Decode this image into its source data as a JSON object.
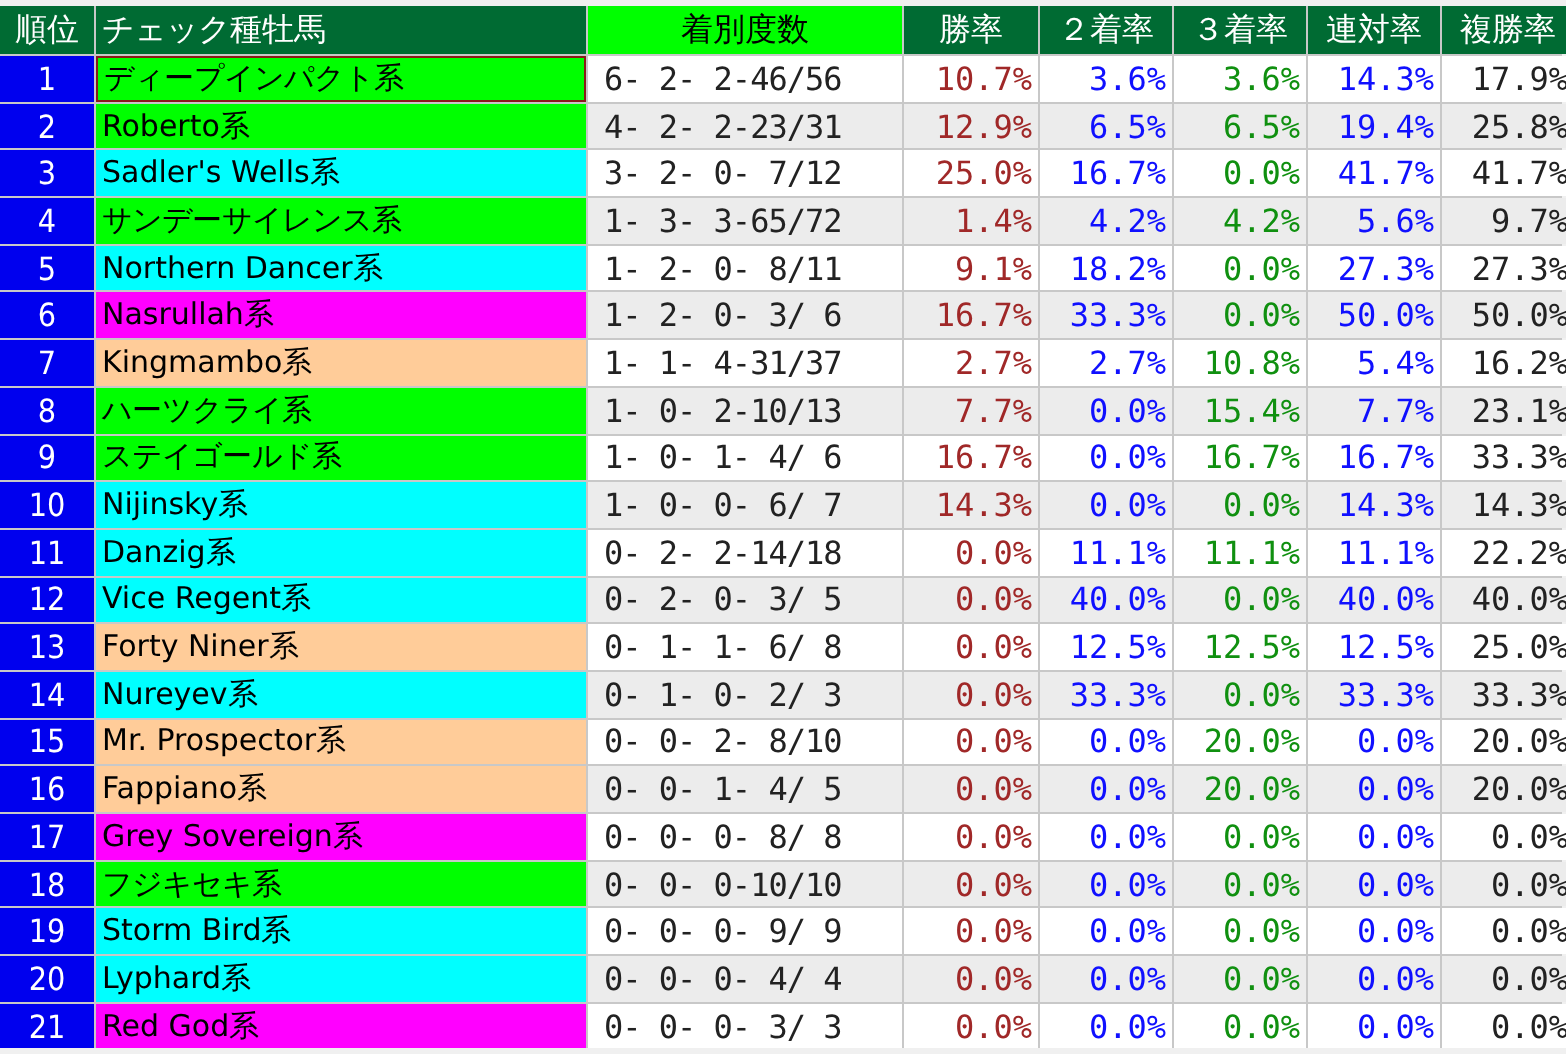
{
  "table": {
    "columns": [
      "順位",
      "チェック種牡馬",
      "着別度数",
      "勝率",
      "２着率",
      "３着率",
      "連対率",
      "複勝率"
    ],
    "rows": [
      {
        "rank": "1",
        "name": "ディープインパクト系",
        "color": "#00ff00",
        "selected": true,
        "record": "6- 2- 2-46/56",
        "win": "10.7%",
        "second": "3.6%",
        "third": "3.6%",
        "top2": "14.3%",
        "top3": "17.9%"
      },
      {
        "rank": "2",
        "name": "Roberto系",
        "color": "#00ff00",
        "selected": false,
        "record": "4- 2- 2-23/31",
        "win": "12.9%",
        "second": "6.5%",
        "third": "6.5%",
        "top2": "19.4%",
        "top3": "25.8%"
      },
      {
        "rank": "3",
        "name": "Sadler's Wells系",
        "color": "#00ffff",
        "selected": false,
        "record": "3- 2- 0- 7/12",
        "win": "25.0%",
        "second": "16.7%",
        "third": "0.0%",
        "top2": "41.7%",
        "top3": "41.7%"
      },
      {
        "rank": "4",
        "name": "サンデーサイレンス系",
        "color": "#00ff00",
        "selected": false,
        "record": "1- 3- 3-65/72",
        "win": "1.4%",
        "second": "4.2%",
        "third": "4.2%",
        "top2": "5.6%",
        "top3": "9.7%"
      },
      {
        "rank": "5",
        "name": "Northern Dancer系",
        "color": "#00ffff",
        "selected": false,
        "record": "1- 2- 0- 8/11",
        "win": "9.1%",
        "second": "18.2%",
        "third": "0.0%",
        "top2": "27.3%",
        "top3": "27.3%"
      },
      {
        "rank": "6",
        "name": "Nasrullah系",
        "color": "#ff00ff",
        "selected": false,
        "record": "1- 2- 0- 3/ 6",
        "win": "16.7%",
        "second": "33.3%",
        "third": "0.0%",
        "top2": "50.0%",
        "top3": "50.0%"
      },
      {
        "rank": "7",
        "name": "Kingmambo系",
        "color": "#ffcc99",
        "selected": false,
        "record": "1- 1- 4-31/37",
        "win": "2.7%",
        "second": "2.7%",
        "third": "10.8%",
        "top2": "5.4%",
        "top3": "16.2%"
      },
      {
        "rank": "8",
        "name": "ハーツクライ系",
        "color": "#00ff00",
        "selected": false,
        "record": "1- 0- 2-10/13",
        "win": "7.7%",
        "second": "0.0%",
        "third": "15.4%",
        "top2": "7.7%",
        "top3": "23.1%"
      },
      {
        "rank": "9",
        "name": "ステイゴールド系",
        "color": "#00ff00",
        "selected": false,
        "record": "1- 0- 1- 4/ 6",
        "win": "16.7%",
        "second": "0.0%",
        "third": "16.7%",
        "top2": "16.7%",
        "top3": "33.3%"
      },
      {
        "rank": "10",
        "name": "Nijinsky系",
        "color": "#00ffff",
        "selected": false,
        "record": "1- 0- 0- 6/ 7",
        "win": "14.3%",
        "second": "0.0%",
        "third": "0.0%",
        "top2": "14.3%",
        "top3": "14.3%"
      },
      {
        "rank": "11",
        "name": "Danzig系",
        "color": "#00ffff",
        "selected": false,
        "record": "0- 2- 2-14/18",
        "win": "0.0%",
        "second": "11.1%",
        "third": "11.1%",
        "top2": "11.1%",
        "top3": "22.2%"
      },
      {
        "rank": "12",
        "name": "Vice Regent系",
        "color": "#00ffff",
        "selected": false,
        "record": "0- 2- 0- 3/ 5",
        "win": "0.0%",
        "second": "40.0%",
        "third": "0.0%",
        "top2": "40.0%",
        "top3": "40.0%"
      },
      {
        "rank": "13",
        "name": "Forty Niner系",
        "color": "#ffcc99",
        "selected": false,
        "record": "0- 1- 1- 6/ 8",
        "win": "0.0%",
        "second": "12.5%",
        "third": "12.5%",
        "top2": "12.5%",
        "top3": "25.0%"
      },
      {
        "rank": "14",
        "name": "Nureyev系",
        "color": "#00ffff",
        "selected": false,
        "record": "0- 1- 0- 2/ 3",
        "win": "0.0%",
        "second": "33.3%",
        "third": "0.0%",
        "top2": "33.3%",
        "top3": "33.3%"
      },
      {
        "rank": "15",
        "name": "Mr. Prospector系",
        "color": "#ffcc99",
        "selected": false,
        "record": "0- 0- 2- 8/10",
        "win": "0.0%",
        "second": "0.0%",
        "third": "20.0%",
        "top2": "0.0%",
        "top3": "20.0%"
      },
      {
        "rank": "16",
        "name": "Fappiano系",
        "color": "#ffcc99",
        "selected": false,
        "record": "0- 0- 1- 4/ 5",
        "win": "0.0%",
        "second": "0.0%",
        "third": "20.0%",
        "top2": "0.0%",
        "top3": "20.0%"
      },
      {
        "rank": "17",
        "name": "Grey Sovereign系",
        "color": "#ff00ff",
        "selected": false,
        "record": "0- 0- 0- 8/ 8",
        "win": "0.0%",
        "second": "0.0%",
        "third": "0.0%",
        "top2": "0.0%",
        "top3": "0.0%"
      },
      {
        "rank": "18",
        "name": "フジキセキ系",
        "color": "#00ff00",
        "selected": false,
        "record": "0- 0- 0-10/10",
        "win": "0.0%",
        "second": "0.0%",
        "third": "0.0%",
        "top2": "0.0%",
        "top3": "0.0%"
      },
      {
        "rank": "19",
        "name": "Storm Bird系",
        "color": "#00ffff",
        "selected": false,
        "record": "0- 0- 0- 9/ 9",
        "win": "0.0%",
        "second": "0.0%",
        "third": "0.0%",
        "top2": "0.0%",
        "top3": "0.0%"
      },
      {
        "rank": "20",
        "name": "Lyphard系",
        "color": "#00ffff",
        "selected": false,
        "record": "0- 0- 0- 4/ 4",
        "win": "0.0%",
        "second": "0.0%",
        "third": "0.0%",
        "top2": "0.0%",
        "top3": "0.0%"
      },
      {
        "rank": "21",
        "name": "Red God系",
        "color": "#ff00ff",
        "selected": false,
        "record": "0- 0- 0- 3/ 3",
        "win": "0.0%",
        "second": "0.0%",
        "third": "0.0%",
        "top2": "0.0%",
        "top3": "0.0%"
      }
    ]
  }
}
